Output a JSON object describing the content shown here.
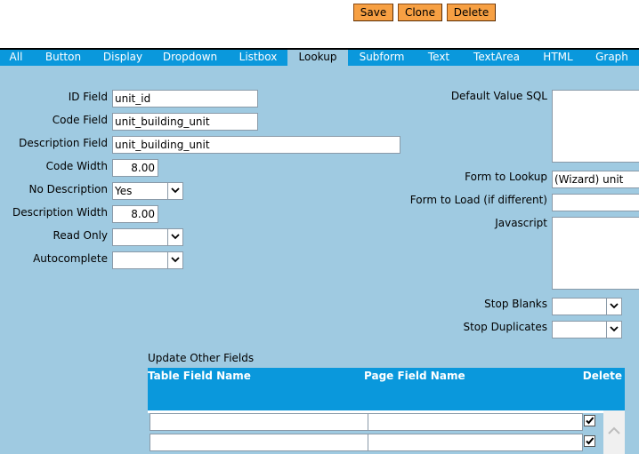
{
  "toolbar": {
    "save_label": "Save",
    "clone_label": "Clone",
    "delete_label": "Delete"
  },
  "tabs": [
    {
      "label": "All"
    },
    {
      "label": "Button"
    },
    {
      "label": "Display"
    },
    {
      "label": "Dropdown"
    },
    {
      "label": "Listbox"
    },
    {
      "label": "Lookup",
      "active": true
    },
    {
      "label": "Subform"
    },
    {
      "label": "Text"
    },
    {
      "label": "TextArea"
    },
    {
      "label": "HTML"
    },
    {
      "label": "Graph"
    }
  ],
  "left_fields": {
    "id_field": {
      "label": "ID Field",
      "value": "unit_id"
    },
    "code_field": {
      "label": "Code Field",
      "value": "unit_building_unit"
    },
    "description_field": {
      "label": "Description Field",
      "value": "unit_building_unit"
    },
    "code_width": {
      "label": "Code Width",
      "value": "8.00"
    },
    "no_description": {
      "label": "No Description",
      "value": "Yes"
    },
    "description_width": {
      "label": "Description Width",
      "value": "8.00"
    },
    "read_only": {
      "label": "Read Only",
      "value": ""
    },
    "autocomplete": {
      "label": "Autocomplete",
      "value": ""
    }
  },
  "right_fields": {
    "default_value_sql": {
      "label": "Default Value SQL",
      "value": ""
    },
    "form_to_lookup": {
      "label": "Form to Lookup",
      "value": "(Wizard) unit"
    },
    "form_to_load": {
      "label": "Form to Load (if different)",
      "value": ""
    },
    "javascript": {
      "label": "Javascript",
      "value": ""
    },
    "stop_blanks": {
      "label": "Stop Blanks",
      "value": ""
    },
    "stop_duplicates": {
      "label": "Stop Duplicates",
      "value": ""
    }
  },
  "update_other_fields": {
    "title": "Update Other Fields",
    "columns": [
      "Table Field Name",
      "Page Field Name",
      "Delete"
    ],
    "rows": [
      {
        "table_field": "",
        "page_field": "",
        "delete": true
      },
      {
        "table_field": "",
        "page_field": "",
        "delete": true
      }
    ]
  },
  "colors": {
    "button_bg": "#f7a043",
    "tab_bar": "#0a98dc",
    "page_bg": "#9fcae1"
  }
}
